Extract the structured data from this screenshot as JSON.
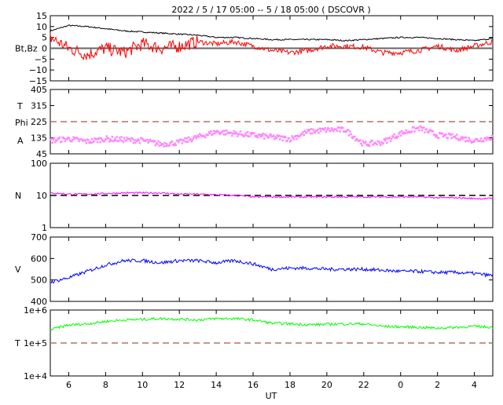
{
  "chart_data": {
    "type": "line",
    "title": "2022 /  5 / 17   05:00 --  5 / 18   05:00 ( DSCOVR )",
    "xlabel": "UT",
    "x_hours": [
      5,
      6,
      7,
      8,
      9,
      10,
      11,
      12,
      13,
      14,
      15,
      16,
      17,
      18,
      19,
      20,
      21,
      22,
      23,
      24,
      25,
      26,
      27,
      28,
      29
    ],
    "x_ticks": [
      "6",
      "8",
      "10",
      "12",
      "14",
      "16",
      "18",
      "20",
      "22",
      "0",
      "2",
      "4"
    ],
    "panels": [
      {
        "label": "Bt,Bz",
        "ylim": [
          -15,
          15
        ],
        "yticks": [
          "15",
          "10",
          "5",
          "0",
          "−5",
          "−10",
          "−15"
        ],
        "reference": 0,
        "series": [
          {
            "name": "Bt",
            "color": "#000000",
            "values": [
              8,
              10.5,
              10,
              9,
              8,
              7.5,
              7,
              6.5,
              6,
              5,
              5,
              4.5,
              4,
              4,
              4,
              4,
              3.5,
              4,
              4.5,
              5,
              5,
              4.5,
              4,
              3.5,
              4.5
            ]
          },
          {
            "name": "Bz",
            "color": "#ff0000",
            "values": [
              5,
              0,
              -3,
              0,
              -2,
              2,
              0,
              1,
              3,
              2,
              3,
              1,
              -1,
              -2,
              -1,
              1,
              1,
              0.5,
              -2,
              -2,
              -1,
              1,
              -1,
              1,
              3
            ]
          }
        ]
      },
      {
        "label": "T\nPhi\nA",
        "ylim": [
          45,
          405
        ],
        "yticks": [
          "405",
          "315",
          "225",
          "135",
          "45"
        ],
        "reference": 225,
        "series": [
          {
            "name": "Phi",
            "color": "#ff88ff",
            "values": [
              120,
              130,
              115,
              130,
              125,
              120,
              100,
              110,
              140,
              170,
              160,
              150,
              140,
              130,
              170,
              180,
              180,
              100,
              110,
              160,
              190,
              150,
              140,
              120,
              140
            ]
          }
        ]
      },
      {
        "label": "N",
        "scale": "log",
        "ylim": [
          1,
          100
        ],
        "yticks": [
          "100",
          "10",
          "1"
        ],
        "reference": 10,
        "series": [
          {
            "name": "N",
            "color": "#ff00ff",
            "values": [
              12,
              11,
              11,
              11.5,
              12,
              12,
              12,
              11,
              11,
              10.5,
              10,
              9,
              9,
              9,
              9,
              9,
              9,
              9,
              9,
              9,
              9,
              8.5,
              8.5,
              8,
              8
            ]
          }
        ]
      },
      {
        "label": "V",
        "ylim": [
          400,
          700
        ],
        "yticks": [
          "700",
          "600",
          "500",
          "400"
        ],
        "series": [
          {
            "name": "V",
            "color": "#0000ff",
            "values": [
              490,
              510,
              540,
              570,
              590,
              590,
              580,
              590,
              590,
              580,
              590,
              575,
              550,
              555,
              555,
              550,
              550,
              550,
              545,
              540,
              540,
              535,
              535,
              530,
              520
            ]
          }
        ]
      },
      {
        "label": "T",
        "scale": "log",
        "ylim": [
          10000,
          1000000
        ],
        "yticks": [
          "1e+6",
          "1e+5",
          "1e+4"
        ],
        "reference": 100000,
        "series": [
          {
            "name": "T",
            "color": "#00ff00",
            "values": [
              250000,
              350000,
              380000,
              450000,
              500000,
              520000,
              550000,
              530000,
              500000,
              550000,
              550000,
              500000,
              400000,
              380000,
              360000,
              370000,
              380000,
              380000,
              320000,
              310000,
              300000,
              280000,
              300000,
              320000,
              300000
            ]
          }
        ]
      }
    ]
  }
}
